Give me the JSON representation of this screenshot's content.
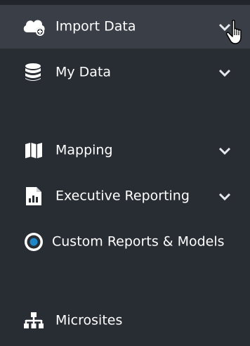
{
  "sidebar": {
    "items": [
      {
        "label": "Import Data",
        "icon": "cloud-upload-icon",
        "expandable": true,
        "hovered": true
      },
      {
        "label": "My Data",
        "icon": "database-icon",
        "expandable": true
      },
      {
        "label": "Mapping",
        "icon": "map-icon",
        "expandable": true
      },
      {
        "label": "Executive Reporting",
        "icon": "report-chart-icon",
        "expandable": true
      },
      {
        "label": "Custom Reports & Models",
        "icon": "target-circle-icon",
        "expandable": false
      },
      {
        "label": "Microsites",
        "icon": "sitemap-icon",
        "expandable": false
      }
    ]
  },
  "colors": {
    "background": "#282d34",
    "hover_background": "#393e47",
    "text": "#ffffff",
    "accent": "#1f87c7"
  }
}
